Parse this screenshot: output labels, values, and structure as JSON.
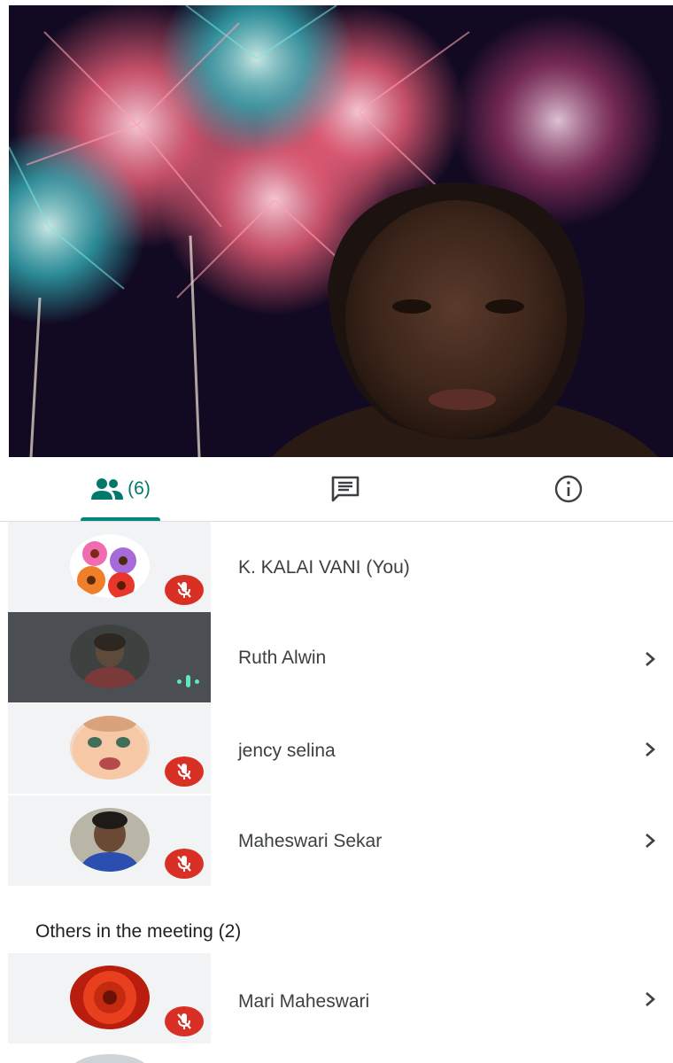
{
  "tabs": {
    "people_count": "(6)",
    "chat_icon": "chat-icon",
    "info_icon": "info-icon",
    "active_color": "#00897b"
  },
  "participants": [
    {
      "name": "K. KALAI VANI (You)",
      "muted": true,
      "avatar": "flowers-avatar"
    },
    {
      "name": "Ruth Alwin",
      "muted": false,
      "speaking": true,
      "avatar": "photo-avatar"
    },
    {
      "name": "jency selina",
      "muted": true,
      "avatar": "baby-avatar"
    },
    {
      "name": "Maheswari Sekar",
      "muted": true,
      "avatar": "boy-avatar"
    }
  ],
  "others_section": {
    "title": "Others in the meeting (2)",
    "participants": [
      {
        "name": "Mari Maheswari",
        "muted": true,
        "avatar": "red-flower-avatar"
      }
    ]
  },
  "colors": {
    "mic_off": "#d93025",
    "speaking": "#5ee7c5",
    "active_tile": "#4b4f53"
  }
}
